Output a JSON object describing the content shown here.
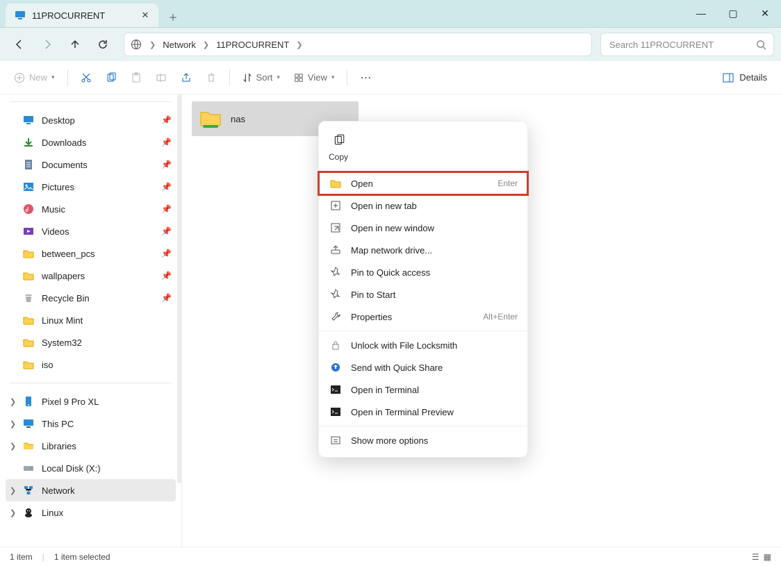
{
  "window": {
    "tab_title": "11PROCURRENT"
  },
  "breadcrumb": {
    "root_icon": "globe-icon",
    "items": [
      "Network",
      "11PROCURRENT"
    ]
  },
  "search": {
    "placeholder": "Search 11PROCURRENT"
  },
  "toolbar": {
    "new": "New",
    "sort": "Sort",
    "view": "View",
    "details": "Details"
  },
  "sidebar": {
    "quick": [
      {
        "label": "Desktop",
        "icon": "desktop",
        "pinned": true
      },
      {
        "label": "Downloads",
        "icon": "download",
        "pinned": true
      },
      {
        "label": "Documents",
        "icon": "document",
        "pinned": true
      },
      {
        "label": "Pictures",
        "icon": "pictures",
        "pinned": true
      },
      {
        "label": "Music",
        "icon": "music",
        "pinned": true
      },
      {
        "label": "Videos",
        "icon": "videos",
        "pinned": true
      },
      {
        "label": "between_pcs",
        "icon": "folder",
        "pinned": true
      },
      {
        "label": "wallpapers",
        "icon": "folder",
        "pinned": true
      },
      {
        "label": "Recycle Bin",
        "icon": "recycle",
        "pinned": true
      },
      {
        "label": "Linux Mint",
        "icon": "folder",
        "pinned": false
      },
      {
        "label": "System32",
        "icon": "folder",
        "pinned": false
      },
      {
        "label": "iso",
        "icon": "folder",
        "pinned": false
      }
    ],
    "locations": [
      {
        "label": "Pixel 9 Pro XL",
        "icon": "phone",
        "chevron": true
      },
      {
        "label": "This PC",
        "icon": "thispc",
        "chevron": true
      },
      {
        "label": "Libraries",
        "icon": "libraries",
        "chevron": true
      },
      {
        "label": "Local Disk (X:)",
        "icon": "disk",
        "chevron": false
      },
      {
        "label": "Network",
        "icon": "network",
        "chevron": true,
        "selected": true
      },
      {
        "label": "Linux",
        "icon": "linux",
        "chevron": true
      }
    ]
  },
  "content": {
    "items": [
      {
        "name": "nas",
        "icon": "shared-folder"
      }
    ]
  },
  "context_menu": {
    "copy_label": "Copy",
    "items": [
      {
        "label": "Open",
        "shortcut": "Enter",
        "icon": "folder-open",
        "highlight": true
      },
      {
        "label": "Open in new tab",
        "icon": "newtab"
      },
      {
        "label": "Open in new window",
        "icon": "newwindow"
      },
      {
        "label": "Map network drive...",
        "icon": "mapdrive"
      },
      {
        "label": "Pin to Quick access",
        "icon": "pin"
      },
      {
        "label": "Pin to Start",
        "icon": "pin"
      },
      {
        "label": "Properties",
        "shortcut": "Alt+Enter",
        "icon": "wrench"
      }
    ],
    "items2": [
      {
        "label": "Unlock with File Locksmith",
        "icon": "lock"
      },
      {
        "label": "Send with Quick Share",
        "icon": "share"
      },
      {
        "label": "Open in Terminal",
        "icon": "terminal"
      },
      {
        "label": "Open in Terminal Preview",
        "icon": "terminal"
      }
    ],
    "more": {
      "label": "Show more options",
      "icon": "more"
    }
  },
  "status": {
    "count": "1 item",
    "selected": "1 item selected"
  }
}
